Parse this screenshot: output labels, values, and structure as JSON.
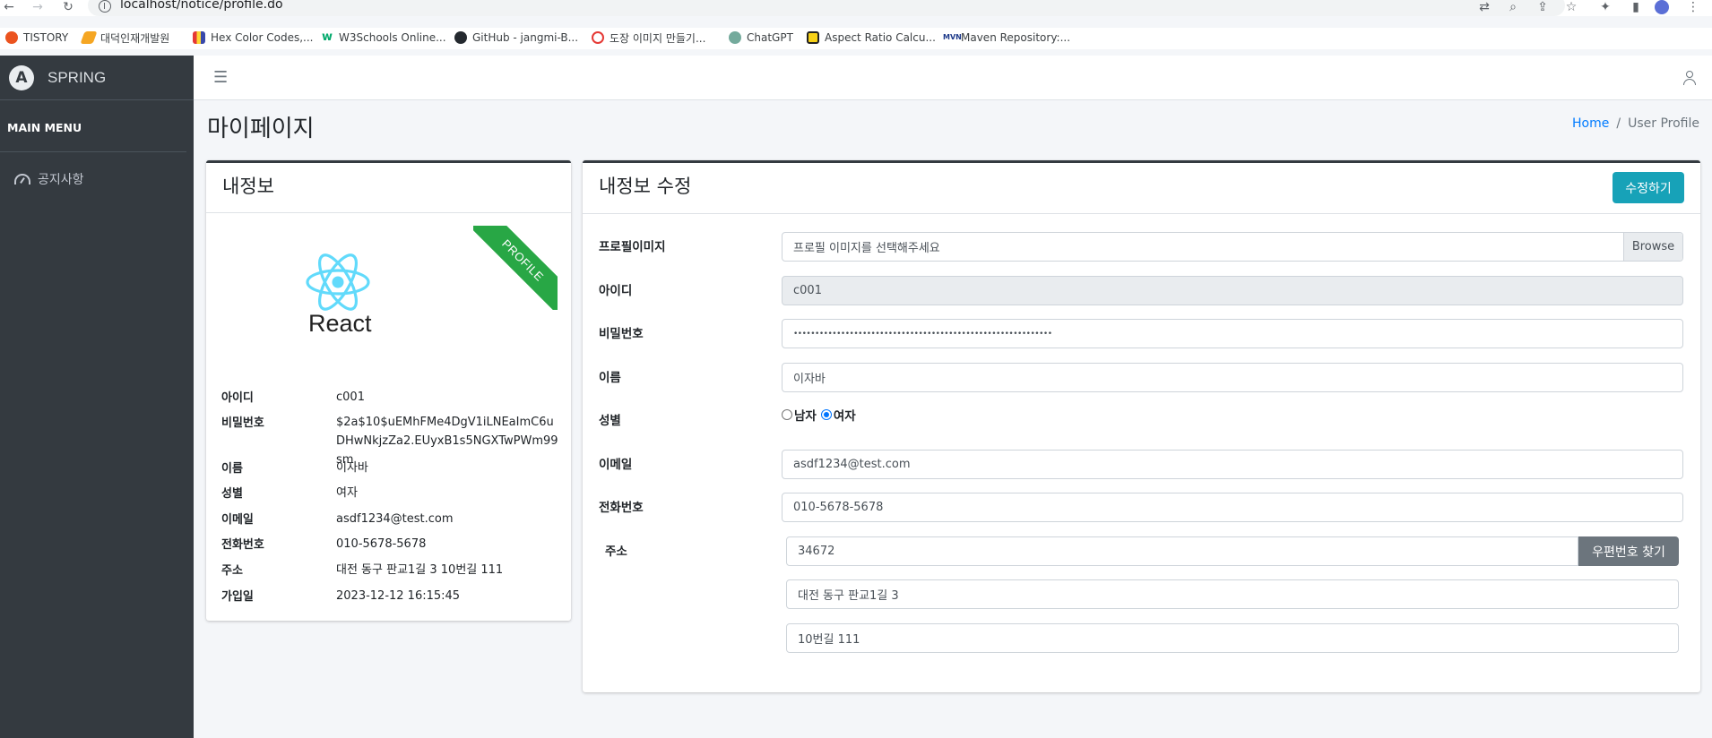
{
  "browser": {
    "url": "localhost/notice/profile.do",
    "bookmarks": [
      {
        "label": "TISTORY",
        "color": "#eb531f"
      },
      {
        "label": "대덕인재개발원",
        "color": "#f5a623"
      },
      {
        "label": "Hex Color Codes,...",
        "color": "#6b3fa0"
      },
      {
        "label": "W3Schools Online...",
        "color": "#04aa6d"
      },
      {
        "label": "GitHub - jangmi-B...",
        "color": "#24292f"
      },
      {
        "label": "도장 이미지 만들기...",
        "color": "#e53935"
      },
      {
        "label": "ChatGPT",
        "color": "#74aa9c"
      },
      {
        "label": "Aspect Ratio Calcu...",
        "color": "#222222"
      },
      {
        "label": "Maven Repository:...",
        "color": "#1e3a8a"
      }
    ]
  },
  "sidebar": {
    "brand": "SPRING",
    "brand_logo": "A",
    "menu_header": "MAIN MENU",
    "items": [
      {
        "label": "공지사항",
        "icon": "dashboard-icon"
      }
    ]
  },
  "page": {
    "title": "마이페이지",
    "breadcrumb": {
      "home": "Home",
      "separator": "/",
      "current": "User Profile"
    }
  },
  "profile_card": {
    "title": "내정보",
    "ribbon": "PROFILE",
    "logo_text": "React",
    "rows": [
      {
        "label": "아이디",
        "value": "c001"
      },
      {
        "label": "비밀번호",
        "value": "$2a$10$uEMhFMe4DgV1iLNEaImC6uDHwNkjzZa2.EUyxB1s5NGXTwPWm99sm"
      },
      {
        "label": "이름",
        "value": "이자바"
      },
      {
        "label": "성별",
        "value": "여자"
      },
      {
        "label": "이메일",
        "value": "asdf1234@test.com"
      },
      {
        "label": "전화번호",
        "value": "010-5678-5678"
      },
      {
        "label": "주소",
        "value": "대전 동구 판교1길 3 10번길 111"
      },
      {
        "label": "가입일",
        "value": "2023-12-12 16:15:45"
      }
    ]
  },
  "edit_card": {
    "title": "내정보 수정",
    "submit_label": "수정하기",
    "fields": {
      "image": {
        "label": "프로필이미지",
        "placeholder": "프로필 이미지를 선택해주세요",
        "browse": "Browse"
      },
      "id": {
        "label": "아이디",
        "value": "c001"
      },
      "password": {
        "label": "비밀번호",
        "value": "••••••••••••••••••••••••••••••••••••••••••••••••••••••••••••"
      },
      "name": {
        "label": "이름",
        "value": "이자바"
      },
      "gender": {
        "label": "성별",
        "options": [
          "남자",
          "여자"
        ],
        "selected": "여자"
      },
      "email": {
        "label": "이메일",
        "value": "asdf1234@test.com"
      },
      "phone": {
        "label": "전화번호",
        "value": "010-5678-5678"
      },
      "address": {
        "label": "주소",
        "zip": "34672",
        "zip_button": "우편번호 찾기",
        "line1": "대전 동구 판교1길 3",
        "line2": "10번길 111"
      }
    }
  },
  "colors": {
    "accent": "#17a2b8",
    "ribbon": "#28a745",
    "sidebar": "#343a40",
    "link": "#007bff",
    "react": "#61dafb"
  }
}
